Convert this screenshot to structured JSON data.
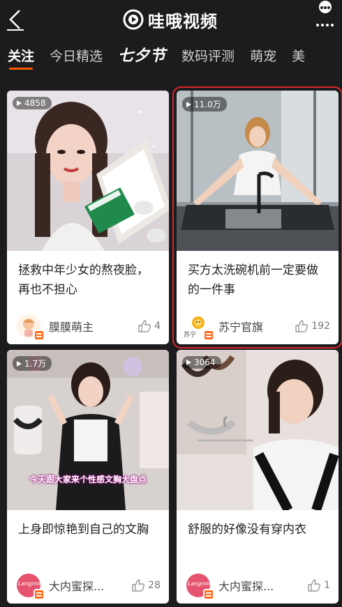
{
  "app": {
    "logo_text": "哇哦视频"
  },
  "tabs": [
    "关注",
    "今日精选",
    "七夕节",
    "数码评测",
    "萌宠",
    "美"
  ],
  "cards": [
    {
      "views": "4858",
      "title": "拯救中年少女的熬夜脸，再也不担心",
      "author": "膜膜萌主",
      "likes": "4"
    },
    {
      "views": "11.0万",
      "title": "买方太洗碗机前一定要做的一件事",
      "author": "苏宁官旗",
      "likes": "192",
      "avatar_text": "苏宁"
    },
    {
      "views": "1.7万",
      "title": "上身即惊艳到自己的文胸",
      "author": "大内蜜探...",
      "likes": "28",
      "avatar_text": "Langmin",
      "caption": "今天跟大家来个性感文胸大盘点"
    },
    {
      "views": "3064",
      "title": "舒服的好像没有穿内衣",
      "author": "大内蜜探...",
      "likes": "1",
      "avatar_text": "Langmin"
    }
  ],
  "colors": {
    "accent": "#ff5a00",
    "selection": "#d9262b",
    "badge": "#ff6a1a"
  }
}
